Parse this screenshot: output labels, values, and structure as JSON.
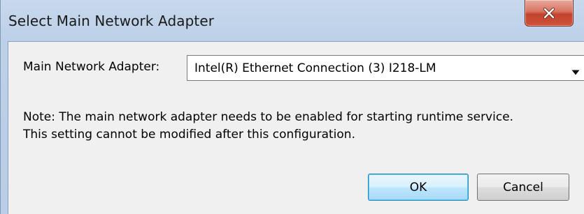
{
  "window": {
    "title": "Select Main Network Adapter",
    "close_icon": "close-icon"
  },
  "form": {
    "adapter_label": "Main Network Adapter:",
    "adapter_value": "Intel(R) Ethernet Connection (3) I218-LM",
    "dropdown_icon": "chevron-down-icon"
  },
  "note": {
    "line1": "Note: The main network adapter needs to be enabled for starting runtime service.",
    "line2": "This setting cannot be modified after this configuration."
  },
  "buttons": {
    "ok_label": "OK",
    "cancel_label": "Cancel"
  },
  "colors": {
    "title_bar": "#bcd0e8",
    "client_bg": "#f0f0f0",
    "close_button": "#c2432d",
    "default_button_border": "#3c7fb1"
  }
}
